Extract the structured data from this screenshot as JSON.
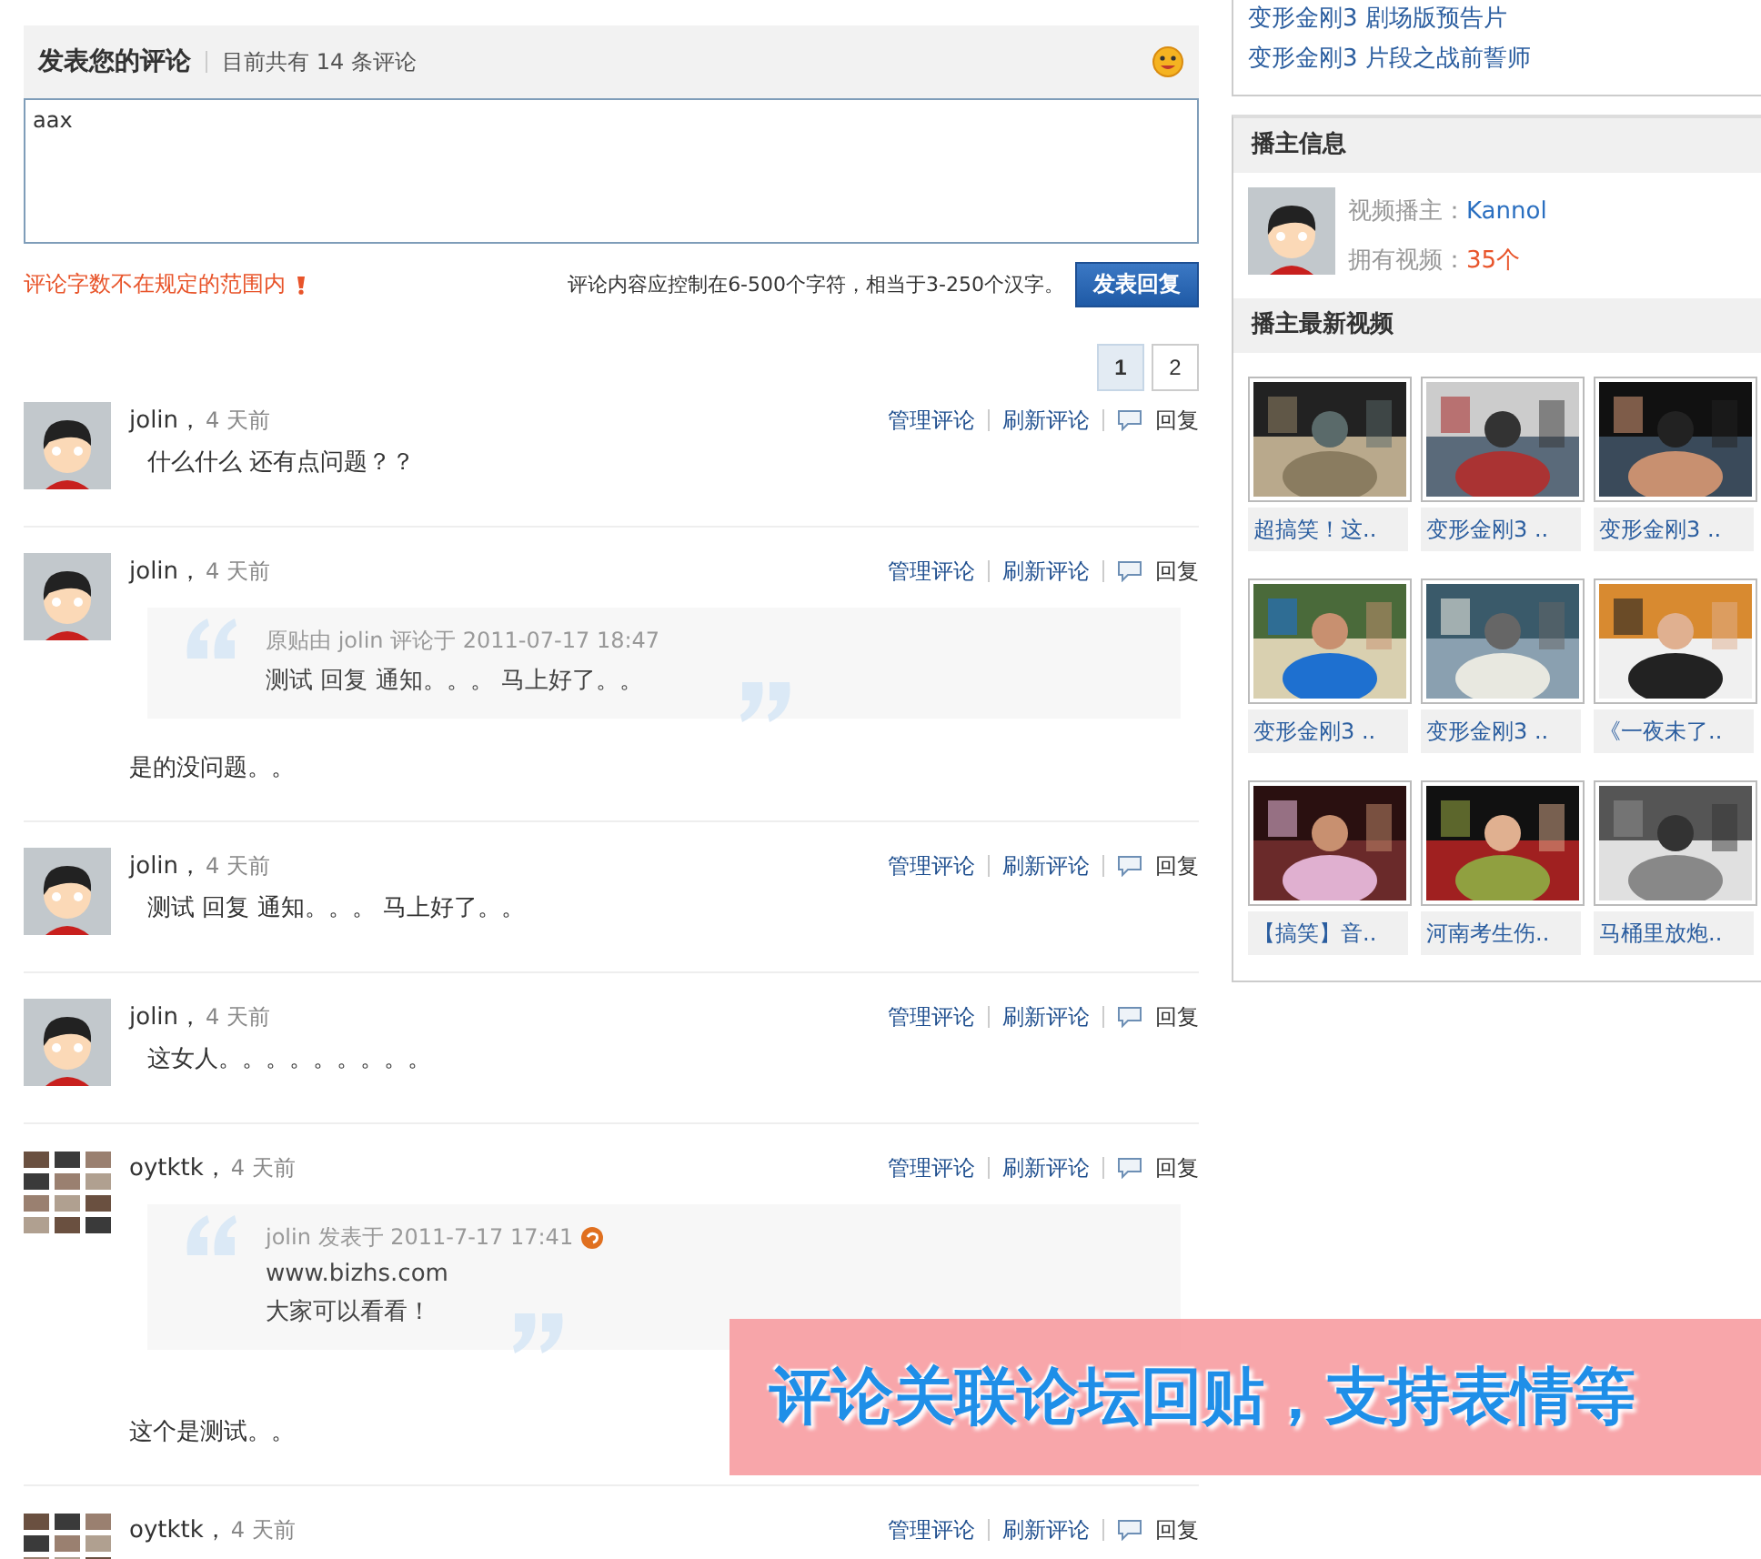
{
  "comment_form": {
    "title": "发表您的评论",
    "count_text": "目前共有 14 条评论",
    "value": "aax",
    "error": "评论字数不在规定的范围内",
    "hint": "评论内容应控制在6-500个字符，相当于3-250个汉字。",
    "submit": "发表回复"
  },
  "pagination": [
    {
      "label": "1",
      "selected": true
    },
    {
      "label": "2",
      "selected": false
    }
  ],
  "comments": [
    {
      "kind": "cartoon",
      "author": "jolin，",
      "time": "4 天前",
      "actions": [
        "管理评论",
        "刷新评论",
        "回复"
      ],
      "body": "什么什么 还有点问题？？"
    },
    {
      "kind": "cartoon",
      "author": "jolin，",
      "time": "4 天前",
      "actions": [
        "管理评论",
        "刷新评论",
        "回复"
      ],
      "quote": {
        "meta": "原贴由 jolin 评论于 2011-07-17 18:47",
        "link_icon": false,
        "lines": [
          "测试 回复 通知。。。 马上好了。。"
        ]
      },
      "body": "是的没问题。。"
    },
    {
      "kind": "cartoon",
      "author": "jolin，",
      "time": "4 天前",
      "actions": [
        "管理评论",
        "刷新评论",
        "回复"
      ],
      "body": "测试 回复 通知。。。 马上好了。。"
    },
    {
      "kind": "cartoon",
      "author": "jolin，",
      "time": "4 天前",
      "actions": [
        "管理评论",
        "刷新评论",
        "回复"
      ],
      "body": "这女人。。。。。。。。。"
    },
    {
      "kind": "thumbnails",
      "author": "oytktk，",
      "time": "4 天前",
      "actions": [
        "管理评论",
        "刷新评论",
        "回复"
      ],
      "quote": {
        "meta": "jolin 发表于 2011-7-17 17:41",
        "link_icon": true,
        "lines": [
          "www.bizhs.com",
          "大家可以看看！"
        ]
      },
      "body": "这个是测试。。"
    },
    {
      "kind": "thumbnails",
      "author": "oytktk，",
      "time": "4 天前",
      "actions": [
        "管理评论",
        "刷新评论",
        "回复"
      ]
    }
  ],
  "sidebar": {
    "related_links": [
      "变形金刚3 剧场版预告片",
      "变形金刚3 片段之战前誓师"
    ],
    "uploader": {
      "title": "播主信息",
      "name_label": "视频播主：",
      "name": "Kannol",
      "count_label": "拥有视频：",
      "count": "35个"
    },
    "latest": {
      "title": "播主最新视频",
      "videos": [
        {
          "title": "超搞笑！这.."
        },
        {
          "title": "变形金刚3 .."
        },
        {
          "title": "变形金刚3 .."
        },
        {
          "title": "变形金刚3 .."
        },
        {
          "title": "变形金刚3 .."
        },
        {
          "title": "《一夜未了.."
        },
        {
          "title": "【搞笑】音.."
        },
        {
          "title": "河南考生伤.."
        },
        {
          "title": "马桶里放炮.."
        }
      ]
    }
  },
  "banner": "评论关联论坛回贴，支持表情等"
}
